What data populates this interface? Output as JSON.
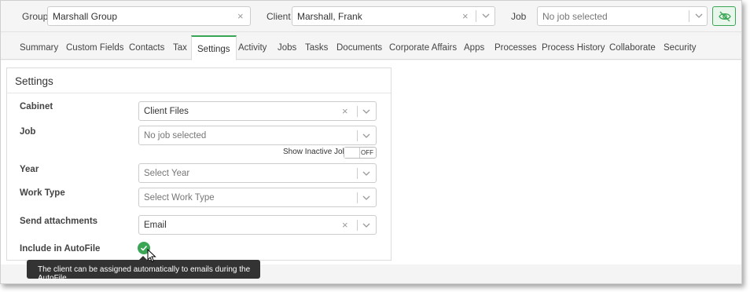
{
  "header": {
    "group": {
      "label": "Group",
      "value": "Marshall Group"
    },
    "client": {
      "label": "Client",
      "value": "Marshall, Frank"
    },
    "job": {
      "label": "Job",
      "placeholder": "No job selected"
    }
  },
  "tabs": [
    {
      "label": "Summary"
    },
    {
      "label": "Custom Fields"
    },
    {
      "label": "Contacts"
    },
    {
      "label": "Tax"
    },
    {
      "label": "Settings",
      "active": true
    },
    {
      "label": "Activity"
    },
    {
      "label": "Jobs"
    },
    {
      "label": "Tasks"
    },
    {
      "label": "Documents"
    },
    {
      "label": "Corporate Affairs"
    },
    {
      "label": "Apps"
    },
    {
      "label": "Processes"
    },
    {
      "label": "Process History"
    },
    {
      "label": "Collaborate"
    },
    {
      "label": "Security"
    }
  ],
  "settings": {
    "title": "Settings",
    "cabinet": {
      "label": "Cabinet",
      "value": "Client Files"
    },
    "job": {
      "label": "Job",
      "placeholder": "No job selected"
    },
    "show_inactive_jobs": {
      "label": "Show Inactive Jobs",
      "state": "OFF"
    },
    "year": {
      "label": "Year",
      "placeholder": "Select Year"
    },
    "work_type": {
      "label": "Work Type",
      "placeholder": "Select Work Type"
    },
    "send_attachments": {
      "label": "Send attachments",
      "value": "Email"
    },
    "include_in_autofile": {
      "label": "Include in AutoFile",
      "checked": true
    }
  },
  "tooltip": {
    "text": "The client can be assigned automatically to emails during the AutoFile"
  },
  "colors": {
    "accent": "#3aa655",
    "tooltip_bg": "#333333"
  },
  "icons": {
    "clear": "close-icon",
    "dropdown": "chevron-down-icon",
    "visibility": "eye-slash-icon",
    "checked": "check-circle-icon",
    "cursor": "mouse-pointer-icon"
  }
}
